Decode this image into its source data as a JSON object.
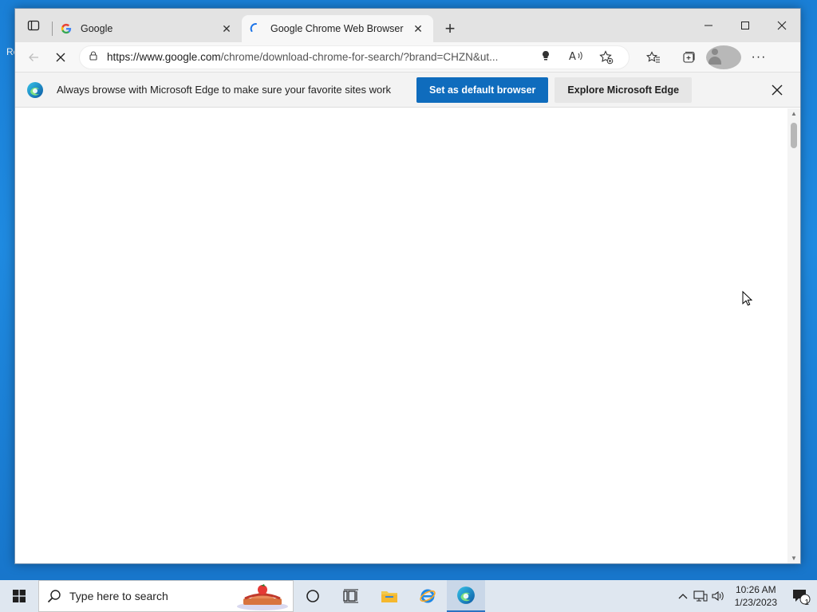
{
  "desktop": {
    "peek_text": "Re"
  },
  "tabs": [
    {
      "title": "Google",
      "favicon": "google-g-icon",
      "state": "inactive"
    },
    {
      "title": "Google Chrome Web Browser",
      "favicon": "loading-spinner-icon",
      "state": "active"
    }
  ],
  "toolbar": {
    "url_host": "https://www.google.com",
    "url_path": "/chrome/download-chrome-for-search/?brand=CHZN&ut..."
  },
  "infobar": {
    "message": "Always browse with Microsoft Edge to make sure your favorite sites work",
    "primary_button": "Set as default browser",
    "secondary_button": "Explore Microsoft Edge"
  },
  "taskbar": {
    "search_placeholder": "Type here to search",
    "time": "10:26 AM",
    "date": "1/23/2023",
    "notification_count": "1"
  },
  "colors": {
    "accent": "#0f6cbd",
    "desktop": "#1f8ae0",
    "taskbar": "#dfe7f0"
  }
}
